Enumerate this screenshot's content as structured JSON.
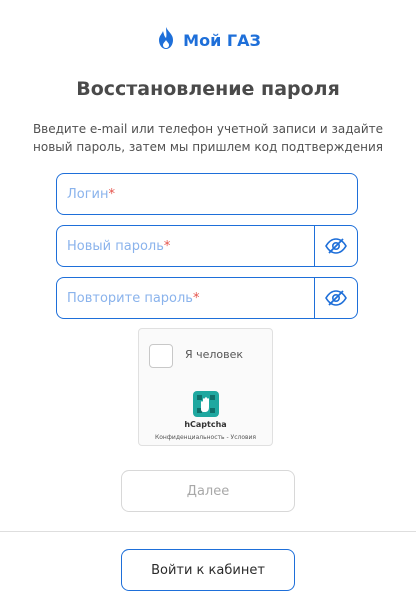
{
  "brand": {
    "name": "Мой ГАЗ",
    "color": "#1e6fd9"
  },
  "page": {
    "title": "Восстановление пароля",
    "description": "Введите e-mail или телефон учетной записи и задайте новый пароль, затем мы пришлем код подтверждения"
  },
  "form": {
    "login": {
      "placeholder": "Логин",
      "required_mark": "*"
    },
    "new_password": {
      "placeholder": "Новый пароль",
      "required_mark": "*",
      "toggle_icon": "eye-off-icon"
    },
    "repeat_password": {
      "placeholder": "Повторите пароль",
      "required_mark": "*",
      "toggle_icon": "eye-off-icon"
    }
  },
  "captcha": {
    "checkbox_label": "Я человек",
    "provider": "hCaptcha",
    "links": "Конфиденциальность - Условия"
  },
  "buttons": {
    "next": "Далее",
    "login_cabinet": "Войти к кабинет"
  }
}
